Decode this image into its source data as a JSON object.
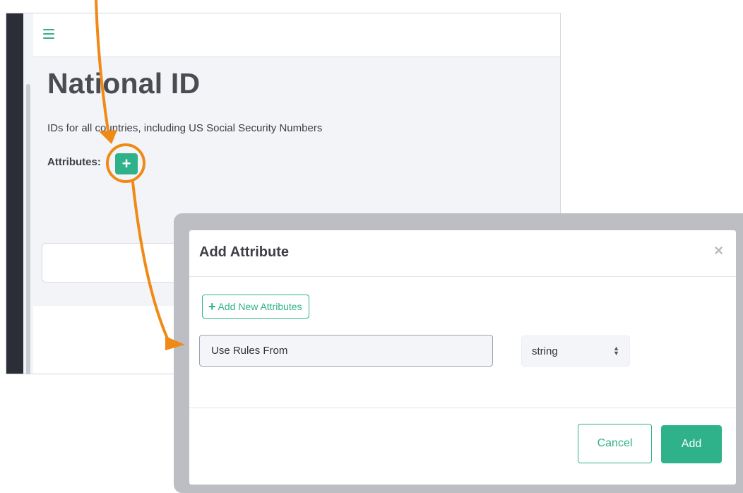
{
  "app": {
    "hamburger_icon": "hamburger-menu-icon",
    "page_title": "National ID",
    "page_subtitle": "IDs for all countries, including US Social Security Numbers",
    "attributes_label": "Attributes:",
    "add_attribute_glyph": "+"
  },
  "modal": {
    "title": "Add Attribute",
    "close_glyph": "×",
    "add_new_glyph": "+",
    "add_new_label": "Add New Attributes",
    "attribute_name_value": "Use Rules From",
    "type_select_value": "string",
    "cancel_label": "Cancel",
    "add_label": "Add"
  },
  "colors": {
    "accent": "#2fb18a",
    "annotation": "#f08a16",
    "sidebar": "#2c2e37"
  }
}
